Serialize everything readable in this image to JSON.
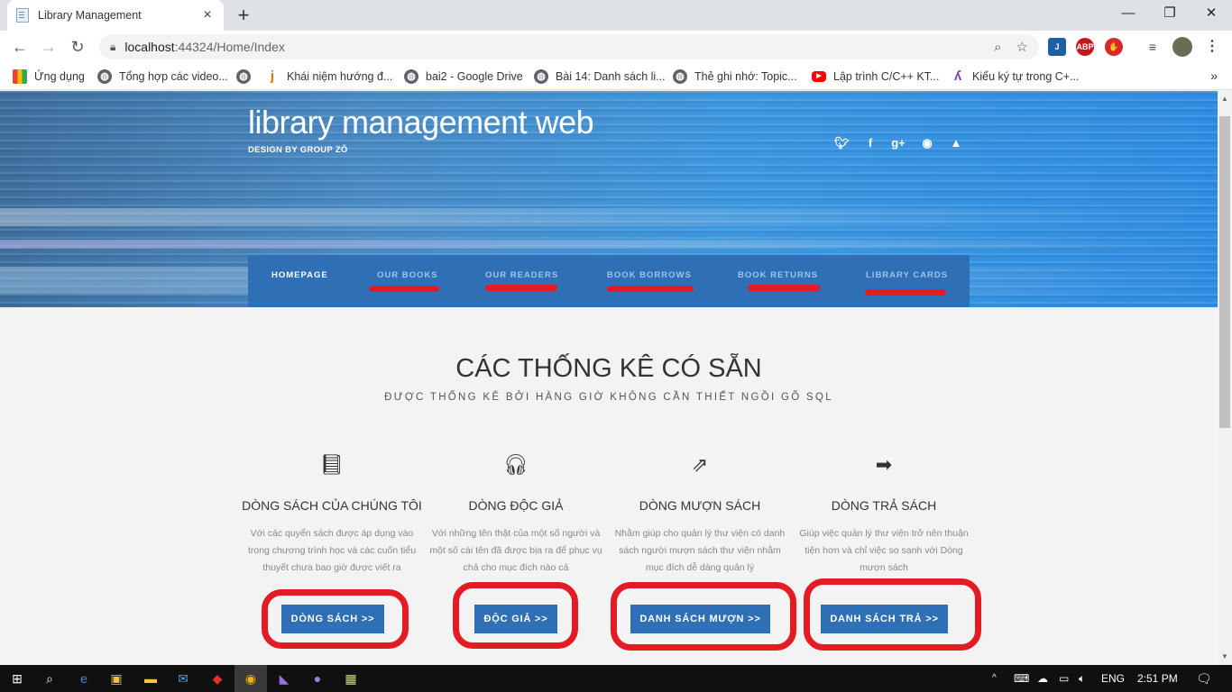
{
  "browser": {
    "tab_title": "Library Management",
    "tab_close": "×",
    "new_tab": "+",
    "url_host": "localhost",
    "url_rest": ":44324/Home/Index",
    "window_minimize": "—",
    "window_restore": "❐",
    "window_close": "✕"
  },
  "bookmarks": [
    {
      "label": "Ứng dụng",
      "icon": "apps-grid-icon"
    },
    {
      "label": "Tổng hợp các video...",
      "icon": "globe-icon"
    },
    {
      "label": "",
      "icon": "globe-icon"
    },
    {
      "label": "Khái niệm hướng đ...",
      "icon": "j-icon"
    },
    {
      "label": "bai2 - Google Drive",
      "icon": "globe-icon"
    },
    {
      "label": "Bài 14: Danh sách li...",
      "icon": "globe-icon"
    },
    {
      "label": "Thẻ ghi nhớ: Topic...",
      "icon": "globe-icon"
    },
    {
      "label": "Lập trình C/C++ KT...",
      "icon": "youtube-icon"
    },
    {
      "label": "Kiểu ký tự trong C+...",
      "icon": "k-icon"
    }
  ],
  "site": {
    "title": "library management web",
    "subtitle": "DESIGN BY GROUP ZÔ",
    "nav": [
      {
        "label": "HOMEPAGE",
        "active": true
      },
      {
        "label": "OUR BOOKS",
        "active": false
      },
      {
        "label": "OUR READERS",
        "active": false
      },
      {
        "label": "BOOK BORROWS",
        "active": false
      },
      {
        "label": "BOOK RETURNS",
        "active": false
      },
      {
        "label": "LIBRARY CARDS",
        "active": false
      }
    ],
    "section_title": "CÁC THỐNG KÊ CÓ SẴN",
    "section_subtitle": "ĐƯỢC THỐNG KÊ BỞI HÀNG GIỜ KHÔNG CẦN THIẾT NGỒI GÕ SQL",
    "features": [
      {
        "icon": "book-icon",
        "title": "DÒNG SÁCH CỦA CHÚNG TÔI",
        "desc": "Với các quyển sách được áp dụng vào trong chương trình học và các cuốn tiểu thuyết chưa bao giờ được viết ra",
        "button": "DÒNG SÁCH >>"
      },
      {
        "icon": "headphones-icon",
        "title": "DÒNG ĐỘC GIẢ",
        "desc": "Với những tên thật của một số người và một số cái tên đã được bịa ra để phục vụ chả cho mục đích nào cả",
        "button": "ĐỘC GIẢ >>"
      },
      {
        "icon": "share-icon",
        "title": "DÒNG MƯỢN SÁCH",
        "desc": "Nhằm giúp cho quản lý thư viện có danh sách người mượn sách thư viện nhằm mục đích dễ dàng quản lý",
        "button": "DANH SÁCH MƯỢN >>"
      },
      {
        "icon": "sign-out-icon",
        "title": "DÒNG TRẢ SÁCH",
        "desc": "Giúp việc quản lý thư viện trở nên thuận tiện hơn và chỉ việc so sanh với Dòng mượn sách",
        "button": "DANH SÁCH TRẢ >>"
      }
    ]
  },
  "taskbar": {
    "language": "ENG",
    "time": "2:51 PM"
  },
  "colors": {
    "nav_bg": "#2f6fb5",
    "button_bg": "#2f6fb5",
    "annotation_red": "#e31b23"
  }
}
